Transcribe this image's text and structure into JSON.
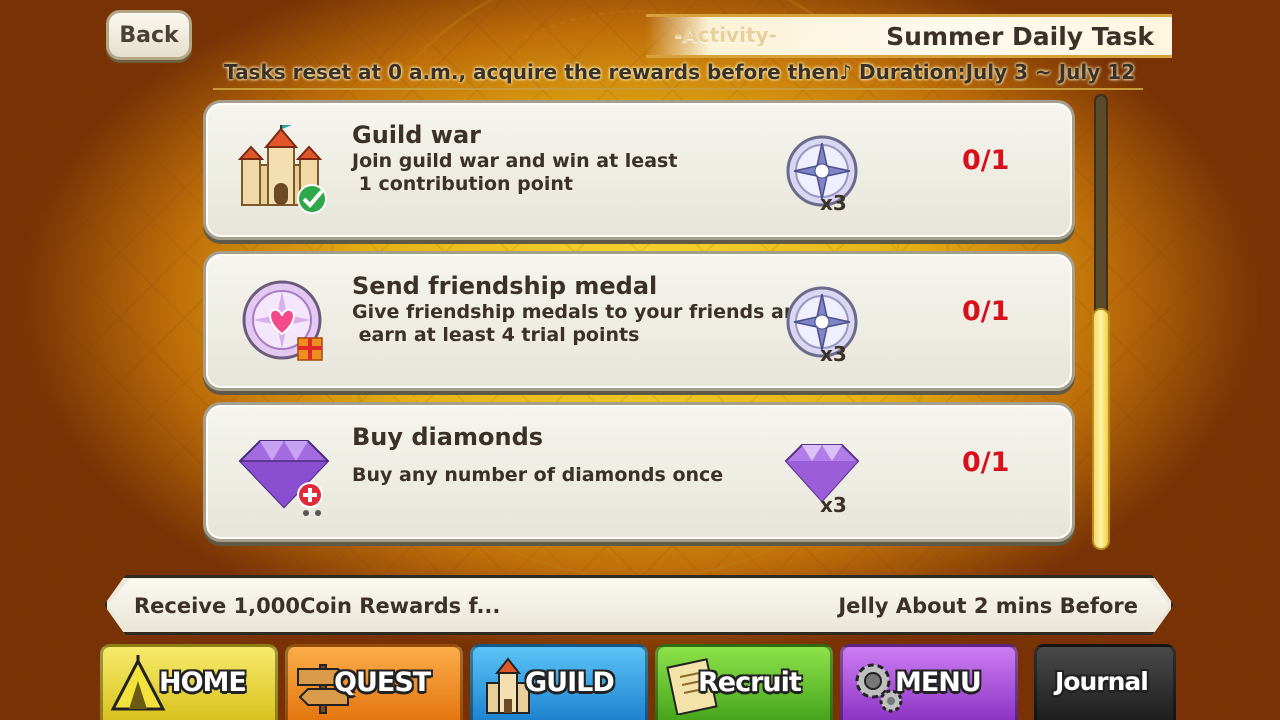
{
  "header": {
    "back_label": "Back",
    "activity_label": "-Activity-",
    "title": "Summer Daily Task",
    "reset_notice": "Tasks reset at 0 a.m., acquire the rewards before then♪ Duration:July 3 ~ July 12"
  },
  "tasks": [
    {
      "title": "Guild war",
      "desc_line1": "Join guild war and win at least",
      "desc_line2": " 1 contribution point",
      "reward_icon": "compass-medal-icon",
      "reward_qty": "x3",
      "progress": "0/1"
    },
    {
      "title": "Send friendship medal",
      "desc_line1": "Give friendship medals to your friends and",
      "desc_line2": " earn at least 4 trial points",
      "reward_icon": "compass-medal-icon",
      "reward_qty": "x3",
      "progress": "0/1"
    },
    {
      "title": "Buy diamonds",
      "desc_line1": "Buy any number of diamonds once",
      "desc_line2": "",
      "reward_icon": "diamond-icon",
      "reward_qty": "x3",
      "progress": "0/1"
    }
  ],
  "news": {
    "left": "Receive 1,000Coin Rewards f...",
    "right": "Jelly About 2 mins Before"
  },
  "nav": [
    {
      "label": "HOME",
      "color": "#e8d23a"
    },
    {
      "label": "QUEST",
      "color": "#f08a1e"
    },
    {
      "label": "GUILD",
      "color": "#2f9ee0"
    },
    {
      "label": "Recruit",
      "color": "#5cbc2a"
    },
    {
      "label": "MENU",
      "color": "#a54ad8"
    },
    {
      "label": "Journal",
      "color": "#3a3a3a"
    }
  ],
  "colors": {
    "progress_red": "#d7101b",
    "text_dark": "#3b3128"
  }
}
